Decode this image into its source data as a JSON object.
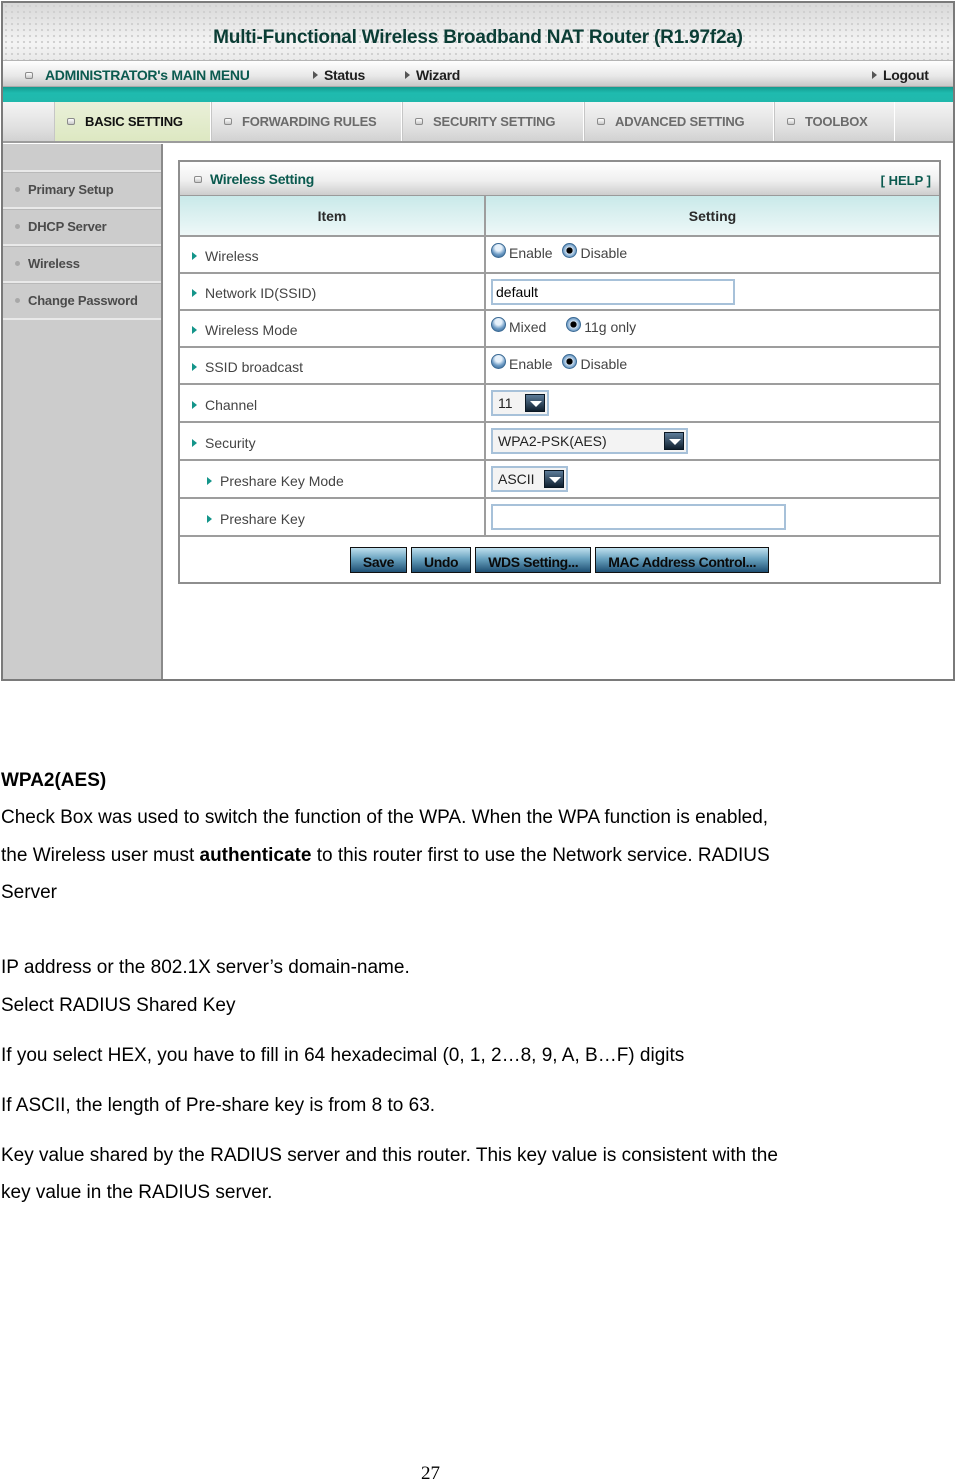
{
  "router": {
    "title": "Multi-Functional Wireless Broadband NAT Router (R1.97f2a)",
    "menubar": {
      "admin_menu": "ADMINISTRATOR's MAIN MENU",
      "status": "Status",
      "wizard": "Wizard",
      "logout": "Logout"
    },
    "tabs": [
      {
        "label": "BASIC SETTING",
        "active": true
      },
      {
        "label": "FORWARDING RULES",
        "active": false
      },
      {
        "label": "SECURITY SETTING",
        "active": false
      },
      {
        "label": "ADVANCED SETTING",
        "active": false
      },
      {
        "label": "TOOLBOX",
        "active": false
      }
    ],
    "sidebar": [
      {
        "label": "Primary Setup"
      },
      {
        "label": "DHCP Server"
      },
      {
        "label": "Wireless"
      },
      {
        "label": "Change Password"
      }
    ],
    "panel": {
      "title": "Wireless Setting",
      "help": "[ HELP ]",
      "col_item": "Item",
      "col_setting": "Setting",
      "rows": {
        "wireless": {
          "label": "Wireless",
          "options": [
            "Enable",
            "Disable"
          ],
          "selected": "Disable"
        },
        "ssid": {
          "label": "Network ID(SSID)",
          "value": "default"
        },
        "mode": {
          "label": "Wireless Mode",
          "options": [
            "Mixed",
            "11g only"
          ],
          "selected": "11g only"
        },
        "broadcast": {
          "label": "SSID broadcast",
          "options": [
            "Enable",
            "Disable"
          ],
          "selected": "Disable"
        },
        "channel": {
          "label": "Channel",
          "value": "11"
        },
        "security": {
          "label": "Security",
          "value": "WPA2-PSK(AES)"
        },
        "key_mode": {
          "label": "Preshare Key Mode",
          "value": "ASCII"
        },
        "key": {
          "label": "Preshare Key",
          "value": ""
        }
      },
      "buttons": {
        "save": "Save",
        "undo": "Undo",
        "wds": "WDS Setting...",
        "mac": "MAC Address Control..."
      }
    },
    "colors": {
      "accent_teal": "#1fbbaf",
      "title_green": "#0b3d35",
      "active_tab": "#dde8c2"
    }
  },
  "document": {
    "heading": "WPA2(AES)",
    "p1_line1": "Check Box was used to switch the function of the WPA. When the WPA function is enabled,",
    "p1_line2_pre": "the Wireless user must ",
    "p1_line2_bold": "authenticate",
    "p1_line2_post": " to this router first to use the Network service. RADIUS",
    "p1_line3": "Server",
    "p2": "IP address or the 802.1X server’s domain-name.",
    "p3": "Select RADIUS Shared Key",
    "p4": "If you select HEX, you have to fill in 64 hexadecimal (0, 1, 2…8, 9, A, B…F) digits",
    "p5": "If ASCII, the length of Pre-share key is from 8 to 63.",
    "p6_line1": "Key value shared by the RADIUS server and this router. This key value is consistent with the",
    "p6_line2": "key value in the RADIUS server.",
    "page_number": "27"
  }
}
